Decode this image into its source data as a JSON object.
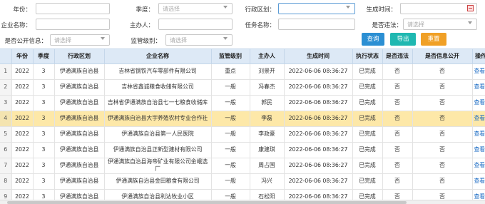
{
  "filters": {
    "year": {
      "label": "年份：",
      "value": ""
    },
    "quarter": {
      "label": "季度：",
      "placeholder": "请选择"
    },
    "region": {
      "label": "行政区划：",
      "value": ""
    },
    "gen_time": {
      "label": "生成时间：",
      "value": ""
    },
    "company": {
      "label": "企业名称：",
      "value": ""
    },
    "organizer": {
      "label": "主办人：",
      "value": ""
    },
    "task_name": {
      "label": "任务名称：",
      "value": ""
    },
    "illegal": {
      "label": "是否违法：",
      "placeholder": "请选择"
    },
    "disclosed": {
      "label": "是否公开信息：",
      "placeholder": "请选择"
    },
    "level": {
      "label": "监管级别：",
      "placeholder": "请选择"
    }
  },
  "buttons": {
    "query": "查询",
    "export": "导出",
    "reset": "重置"
  },
  "table": {
    "headers": [
      "",
      "年份",
      "季度",
      "行政区划",
      "企业名称",
      "监管级别",
      "主办人",
      "生成时间",
      "执行状态",
      "是否违法",
      "是否信息公开",
      "操作"
    ],
    "rows": [
      [
        "1",
        "2022",
        "3",
        "伊通满族自治县",
        "吉林省钢铁汽车零部件有限公司",
        "重点",
        "刘景开",
        "2022-06-06 08:36:27",
        "已完成",
        "否",
        "否",
        "查看"
      ],
      [
        "2",
        "2022",
        "3",
        "伊通满族自治县",
        "吉林省鑫诚粮食收储有限公司",
        "一般",
        "冯春杰",
        "2022-06-06 08:36:27",
        "已完成",
        "否",
        "否",
        "查看"
      ],
      [
        "3",
        "2022",
        "3",
        "伊通满族自治县",
        "吉林省伊通满族自治县七一七粮食收储库",
        "一般",
        "郭民",
        "2022-06-06 08:36:27",
        "已完成",
        "否",
        "否",
        "查看"
      ],
      [
        "4",
        "2022",
        "3",
        "伊通满族自治县",
        "伊通满族自治县大宇养殖农村专业合作社",
        "一般",
        "李磊",
        "2022-06-06 08:36:27",
        "已完成",
        "否",
        "否",
        "查看"
      ],
      [
        "5",
        "2022",
        "3",
        "伊通满族自治县",
        "伊通满族自治县第一人民医院",
        "一般",
        "李政豪",
        "2022-06-06 08:36:27",
        "已完成",
        "否",
        "否",
        "查看"
      ],
      [
        "6",
        "2022",
        "3",
        "伊通满族自治县",
        "伊通满族自治县正新型建材有限公司",
        "一般",
        "康建琪",
        "2022-06-06 08:36:27",
        "已完成",
        "否",
        "否",
        "查看"
      ],
      [
        "7",
        "2022",
        "3",
        "伊通满族自治县",
        "伊通满族自治县海帝矿业有限公司金峨选厂",
        "一般",
        "周占国",
        "2022-06-06 08:36:27",
        "已完成",
        "否",
        "否",
        "查看"
      ],
      [
        "8",
        "2022",
        "3",
        "伊通满族自治县",
        "伊通满族自治县金田粮食有限公司",
        "一般",
        "冯兴",
        "2022-06-06 08:36:27",
        "已完成",
        "否",
        "否",
        "查看"
      ],
      [
        "9",
        "2022",
        "3",
        "伊通满族自治县",
        "伊通满族自治县利达牧业小区",
        "一般",
        "石松阳",
        "2022-06-06 08:36:27",
        "已完成",
        "否",
        "否",
        "查看"
      ]
    ],
    "selected_row": 4
  }
}
